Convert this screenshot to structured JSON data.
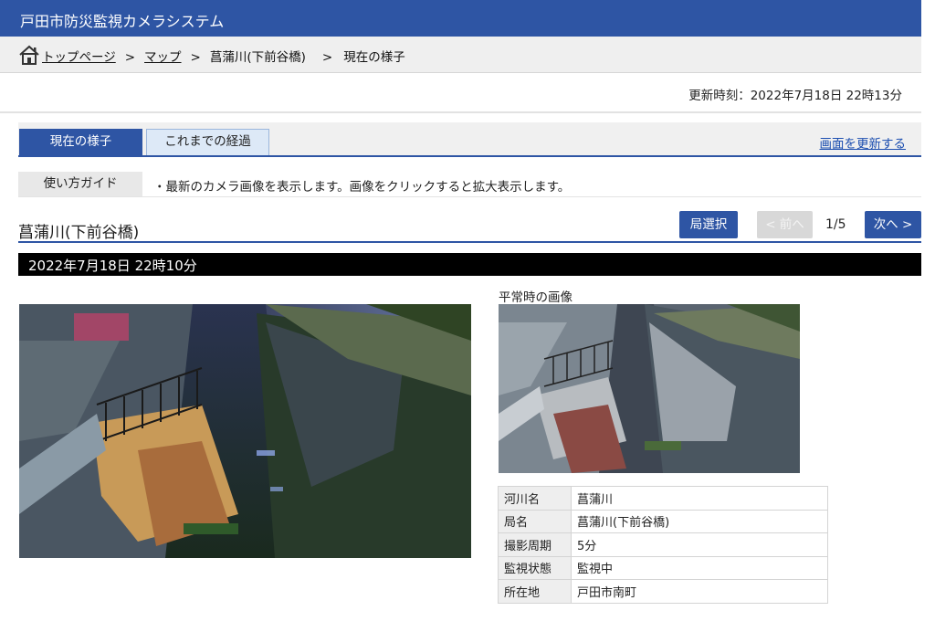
{
  "header": {
    "title": "戸田市防災監視カメラシステム"
  },
  "breadcrumb": {
    "home_icon": "home-icon",
    "top": "トップページ",
    "map": "マップ",
    "station": "菖蒲川(下前谷橋)",
    "current": "現在の様子",
    "separator": ">"
  },
  "updated": "更新時刻：2022年7月18日 22時13分",
  "tabs": {
    "current": "現在の様子",
    "history": "これまでの経過",
    "refresh": "画面を更新する"
  },
  "guide": {
    "label": "使い方ガイド",
    "text": "・最新のカメラ画像を表示します。画像をクリックすると拡大表示します。"
  },
  "station": {
    "title": "菖蒲川(下前谷橋)",
    "select_button": "局選択",
    "prev_button": "< 前へ",
    "page": "1/5",
    "next_button": "次へ >"
  },
  "capture_datetime": "2022年7月18日 22時10分",
  "normal_image_label": "平常時の画像",
  "info": [
    {
      "key": "河川名",
      "value": "菖蒲川"
    },
    {
      "key": "局名",
      "value": "菖蒲川(下前谷橋)"
    },
    {
      "key": "撮影周期",
      "value": "5分"
    },
    {
      "key": "監視状態",
      "value": "監視中"
    },
    {
      "key": "所在地",
      "value": "戸田市南町"
    }
  ],
  "colors": {
    "brand": "#2e55a4",
    "link": "#1d4fb0",
    "disabled": "#d8d8d8"
  }
}
